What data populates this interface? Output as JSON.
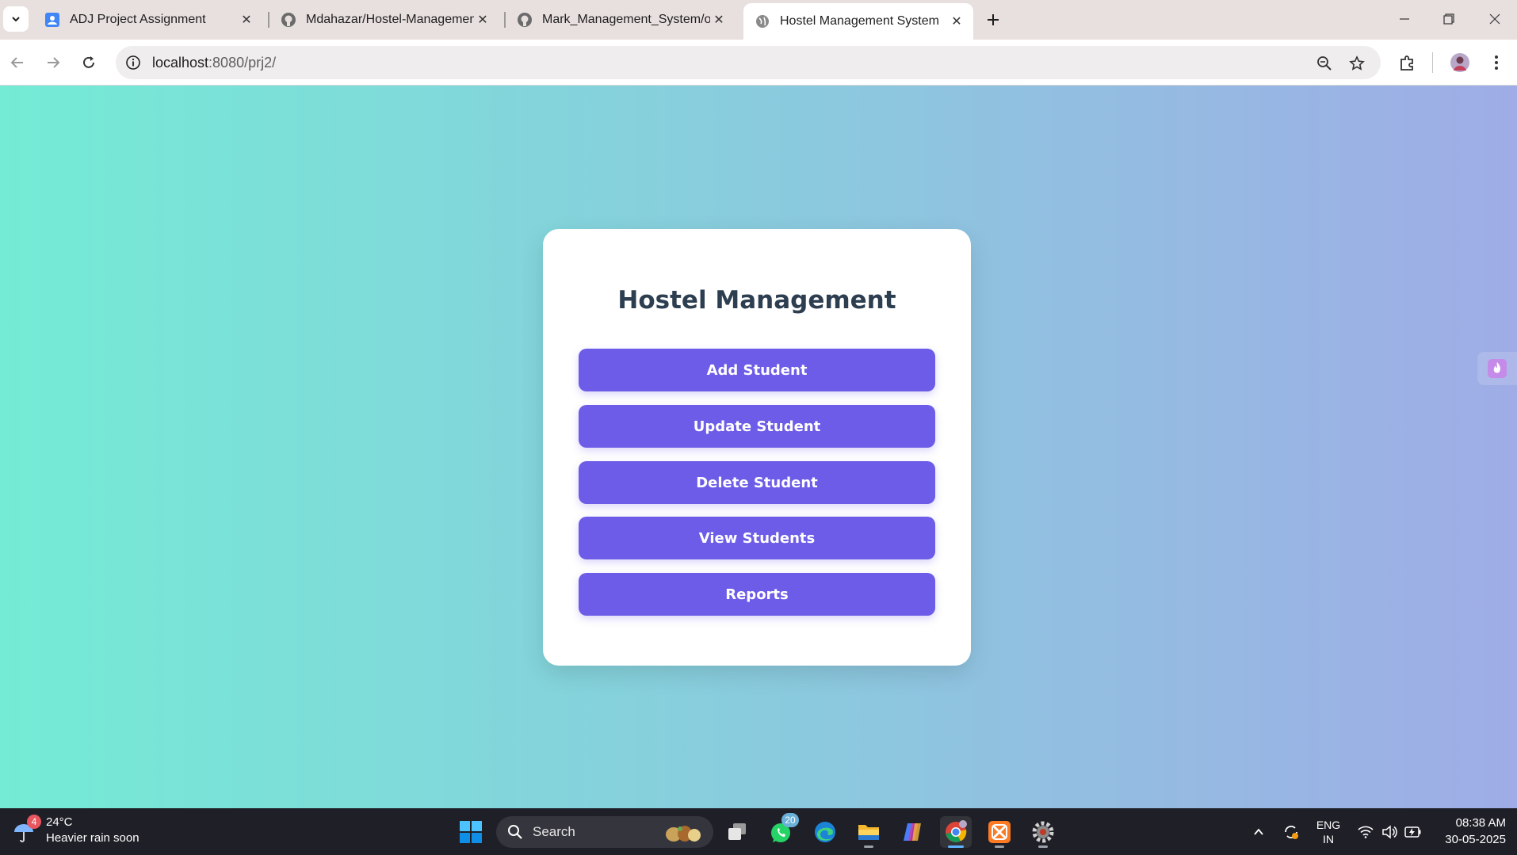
{
  "browser": {
    "tabs": [
      {
        "title": "ADJ Project Assignment",
        "favicon": "google-forms-icon",
        "active": false
      },
      {
        "title": "Mdahazar/Hostel-Management-System",
        "favicon": "github-icon",
        "active": false
      },
      {
        "title": "Mark_Management_System/out",
        "favicon": "github-icon",
        "active": false
      },
      {
        "title": "Hostel Management System",
        "favicon": "globe-icon",
        "active": true
      }
    ],
    "url_host": "localhost",
    "url_path": ":8080/prj2/"
  },
  "page": {
    "title": "Hostel Management",
    "buttons": [
      "Add Student",
      "Update Student",
      "Delete Student",
      "View Students",
      "Reports"
    ],
    "gradient_start": "#74ebd5",
    "gradient_end": "#9face6",
    "button_color": "#6c5ce7",
    "title_color": "#2c3e50"
  },
  "taskbar": {
    "weather_temp": "24°C",
    "weather_desc": "Heavier rain soon",
    "weather_badge": "4",
    "search_label": "Search",
    "whatsapp_badge": "20",
    "lang_line1": "ENG",
    "lang_line2": "IN",
    "time": "08:38 AM",
    "date": "30-05-2025"
  }
}
